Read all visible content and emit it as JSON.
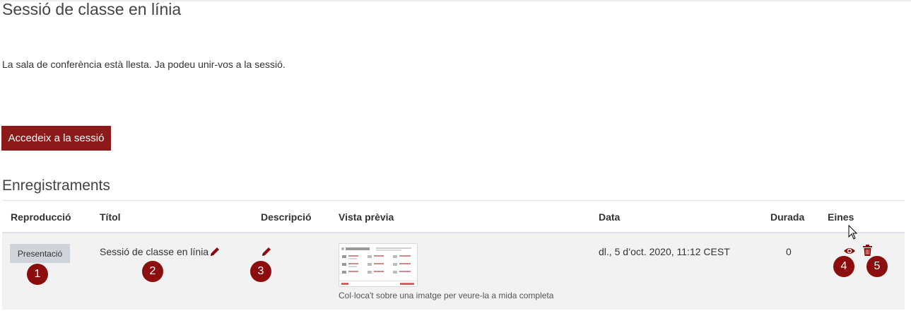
{
  "page": {
    "title": "Sessió de classe en línia",
    "status_message": "La sala de conferència està llesta. Ja podeu unir-vos a la sessió.",
    "join_button": "Accedeix a la sessió"
  },
  "recordings": {
    "heading": "Enregistraments",
    "columns": [
      "Reproducció",
      "Títol",
      "Descripció",
      "Vista prèvia",
      "Data",
      "Durada",
      "Eines"
    ],
    "rows": [
      {
        "playback_button": "Presentació",
        "title": "Sessió de classe en línia",
        "description": "",
        "preview_caption": "Col·loca't sobre una imatge per veure-la a mida completa",
        "date": "dl., 5 d’oct. 2020, 11:12 CEST",
        "duration": "0"
      }
    ]
  },
  "badges": [
    "1",
    "2",
    "3",
    "4",
    "5"
  ],
  "icons": {
    "edit_title": "pencil-icon",
    "edit_description": "pencil-icon",
    "view": "eye-icon",
    "delete": "trash-icon"
  },
  "colors": {
    "accent": "#8d1a1a",
    "badge": "#8b0d0d",
    "row_background": "#f2f2f2"
  }
}
